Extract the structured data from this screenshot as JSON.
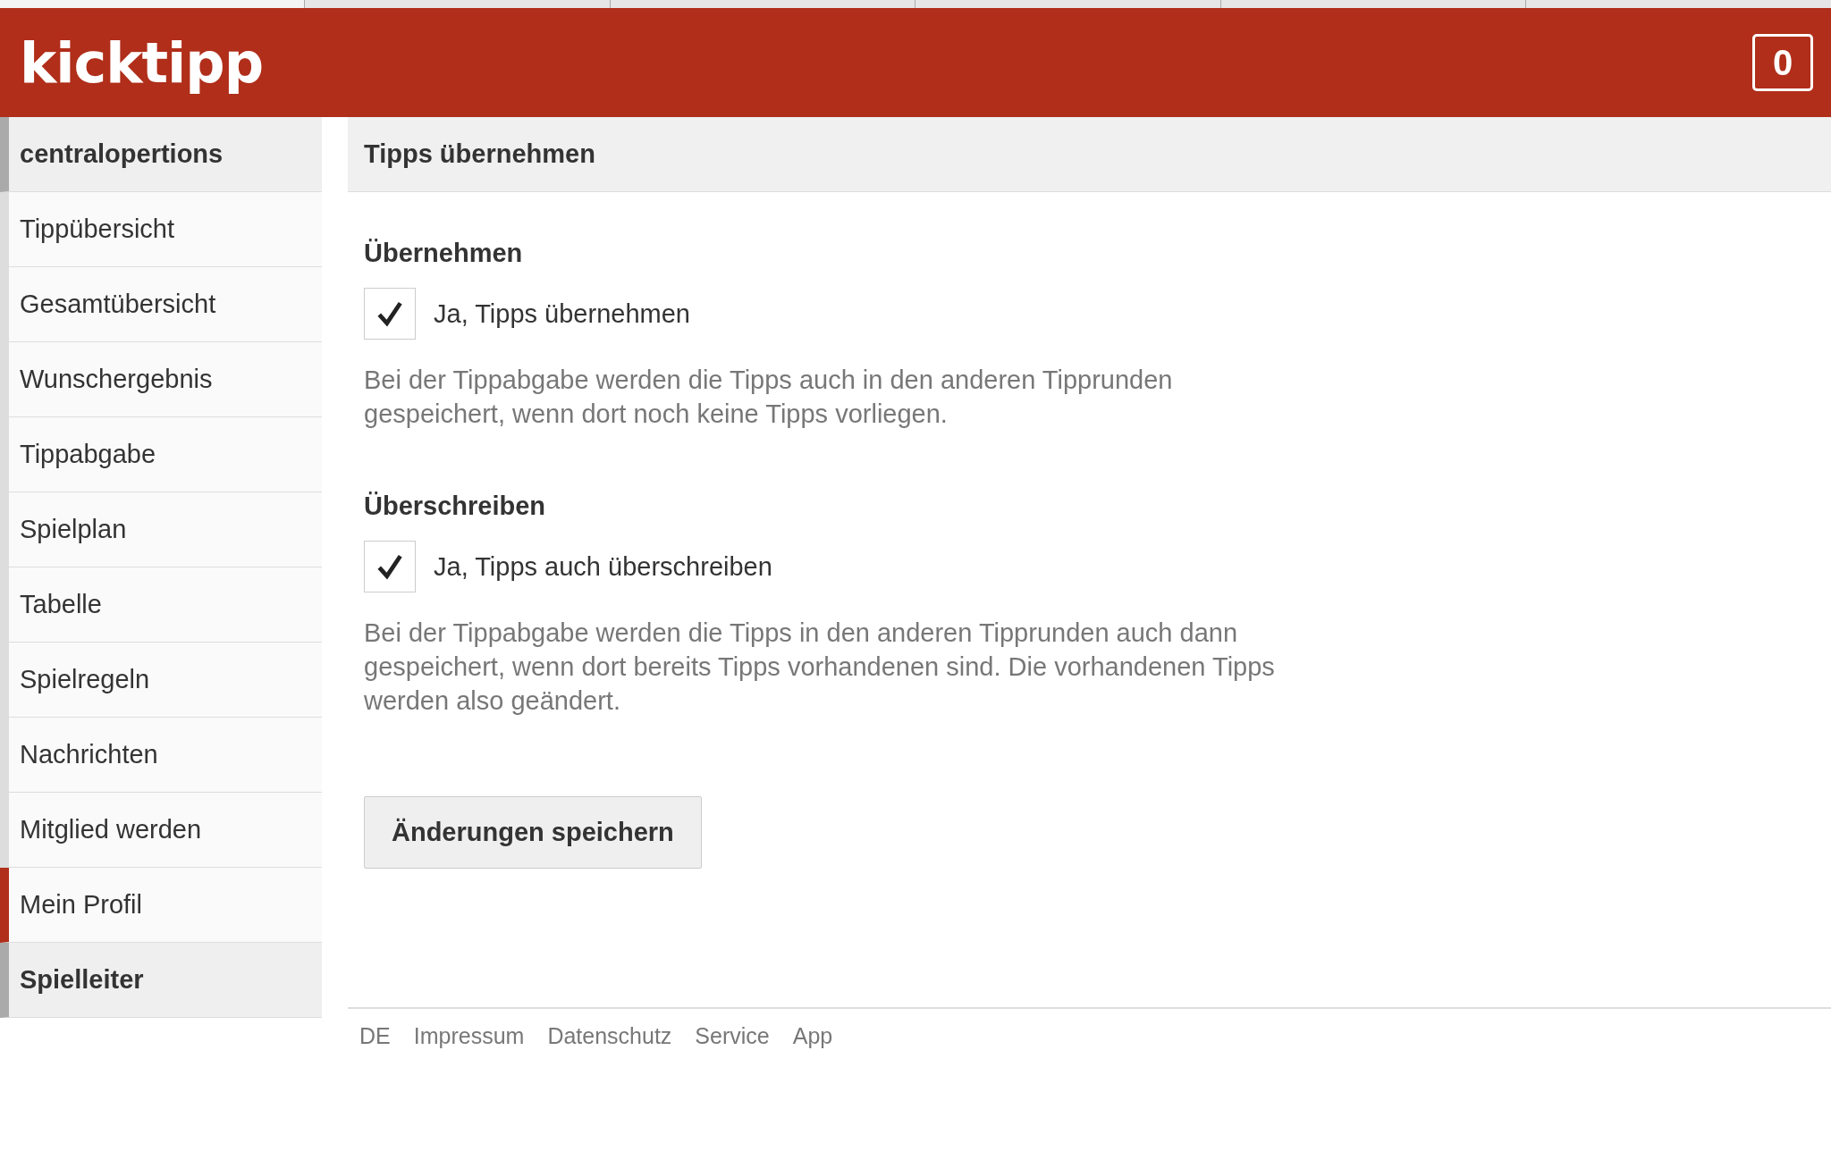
{
  "browser_tabs": [
    {
      "selected": true
    },
    {
      "selected": false
    },
    {
      "selected": false
    },
    {
      "selected": false
    },
    {
      "selected": false
    },
    {
      "selected": false
    }
  ],
  "header": {
    "logo": "kicktipp",
    "badge": "0"
  },
  "sidebar": {
    "items": [
      {
        "kind": "group",
        "label": "centralopertions",
        "selected": false
      },
      {
        "kind": "link",
        "label": "Tippübersicht",
        "selected": false
      },
      {
        "kind": "link",
        "label": "Gesamtübersicht",
        "selected": false
      },
      {
        "kind": "link",
        "label": "Wunschergebnis",
        "selected": false
      },
      {
        "kind": "link",
        "label": "Tippabgabe",
        "selected": false
      },
      {
        "kind": "link",
        "label": "Spielplan",
        "selected": false
      },
      {
        "kind": "link",
        "label": "Tabelle",
        "selected": false
      },
      {
        "kind": "link",
        "label": "Spielregeln",
        "selected": false
      },
      {
        "kind": "link",
        "label": "Nachrichten",
        "selected": false
      },
      {
        "kind": "link",
        "label": "Mitglied werden",
        "selected": false
      },
      {
        "kind": "link",
        "label": "Mein Profil",
        "selected": true
      },
      {
        "kind": "group",
        "label": "Spielleiter",
        "selected": false
      }
    ]
  },
  "main": {
    "title": "Tipps übernehmen",
    "sections": [
      {
        "heading": "Übernehmen",
        "checkbox_label": "Ja, Tipps übernehmen",
        "checked": true,
        "description": "Bei der Tippabgabe werden die Tipps auch in den anderen Tipprunden gespeichert, wenn dort noch keine Tipps vorliegen."
      },
      {
        "heading": "Überschreiben",
        "checkbox_label": "Ja, Tipps auch überschreiben",
        "checked": true,
        "description": "Bei der Tippabgabe werden die Tipps in den anderen Tipprunden auch dann gespeichert, wenn dort bereits Tipps vorhandenen sind. Die vorhandenen Tipps werden also geändert."
      }
    ],
    "save_button": "Änderungen speichern"
  },
  "footer": {
    "links": [
      "DE",
      "Impressum",
      "Datenschutz",
      "Service",
      "App"
    ]
  }
}
